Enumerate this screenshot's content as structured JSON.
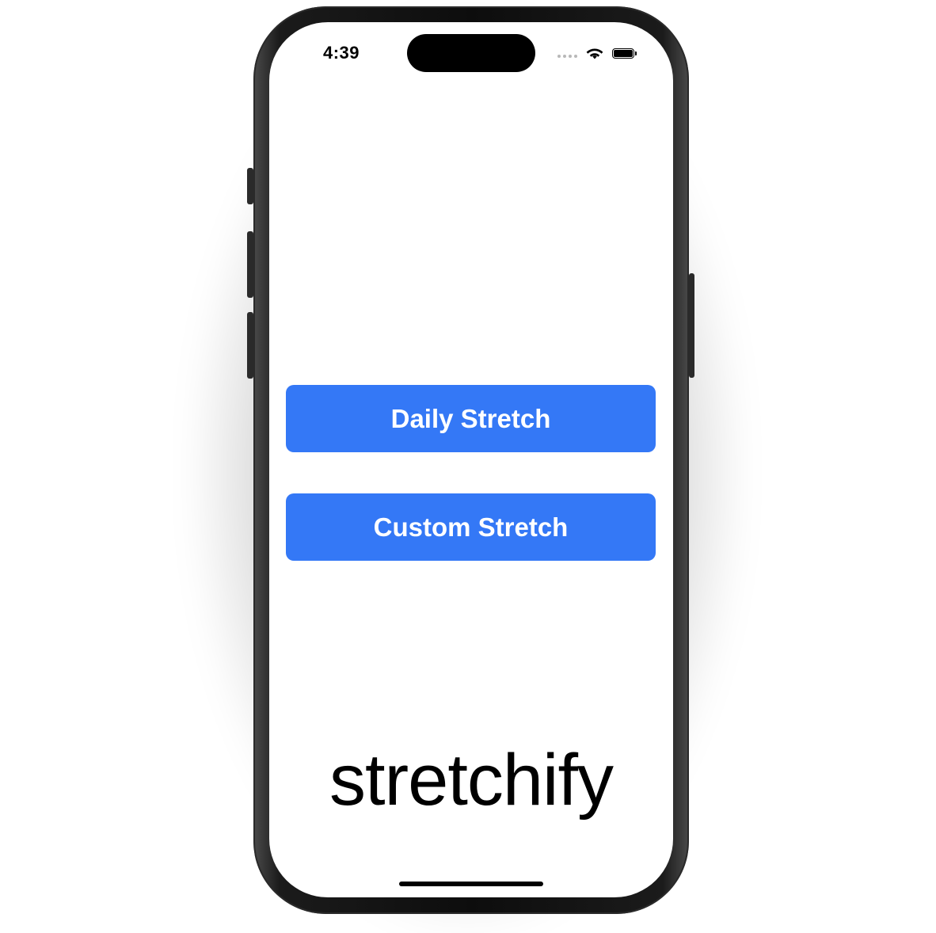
{
  "status_bar": {
    "time": "4:39"
  },
  "buttons": {
    "daily_stretch": "Daily Stretch",
    "custom_stretch": "Custom Stretch"
  },
  "brand": {
    "name": "stretchify"
  },
  "colors": {
    "button_background": "#3478f6",
    "button_text": "#ffffff",
    "screen_background": "#ffffff"
  }
}
